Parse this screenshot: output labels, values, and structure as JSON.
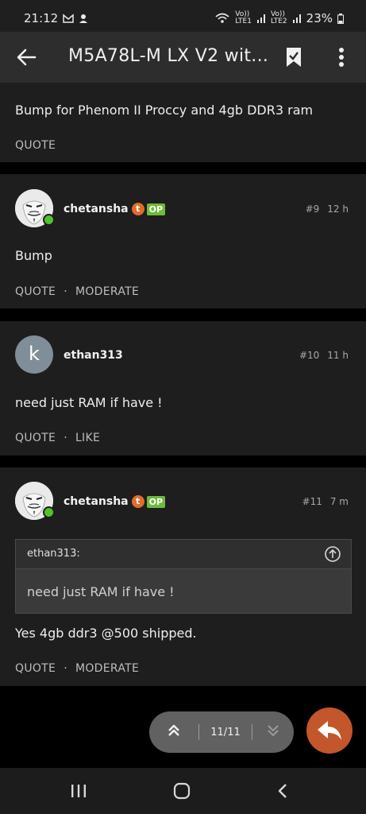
{
  "status": {
    "time": "21:12",
    "lte1_label": "Vo))\nLTE1",
    "lte2_label": "Vo))\nLTE2",
    "battery": "23%"
  },
  "appbar": {
    "title": "M5A78L-M LX V2 wit..."
  },
  "posts": [
    {
      "body": "Bump for Phenom II Proccy and 4gb DDR3 ram",
      "actions": [
        "QUOTE"
      ]
    },
    {
      "username": "chetansha",
      "badge_t": "t",
      "badge_op": "OP",
      "number": "#9",
      "time": "12 h",
      "body": "Bump",
      "actions": [
        "QUOTE",
        "MODERATE"
      ]
    },
    {
      "username": "ethan313",
      "avatar_letter": "k",
      "number": "#10",
      "time": "11 h",
      "body": "need just RAM if have !",
      "actions": [
        "QUOTE",
        "LIKE"
      ]
    },
    {
      "username": "chetansha",
      "badge_t": "t",
      "badge_op": "OP",
      "number": "#11",
      "time": "7 m",
      "quote": {
        "author": "ethan313:",
        "text": "need just RAM if have !"
      },
      "body": "Yes 4gb ddr3 @500 shipped.",
      "actions": [
        "QUOTE",
        "MODERATE"
      ]
    }
  ],
  "nav": {
    "count": "11/11"
  },
  "colors": {
    "post_bg": "#1e1e1e",
    "reply_button": "#c3562a",
    "op_badge": "#6dbb3b",
    "online": "#55c02f"
  }
}
